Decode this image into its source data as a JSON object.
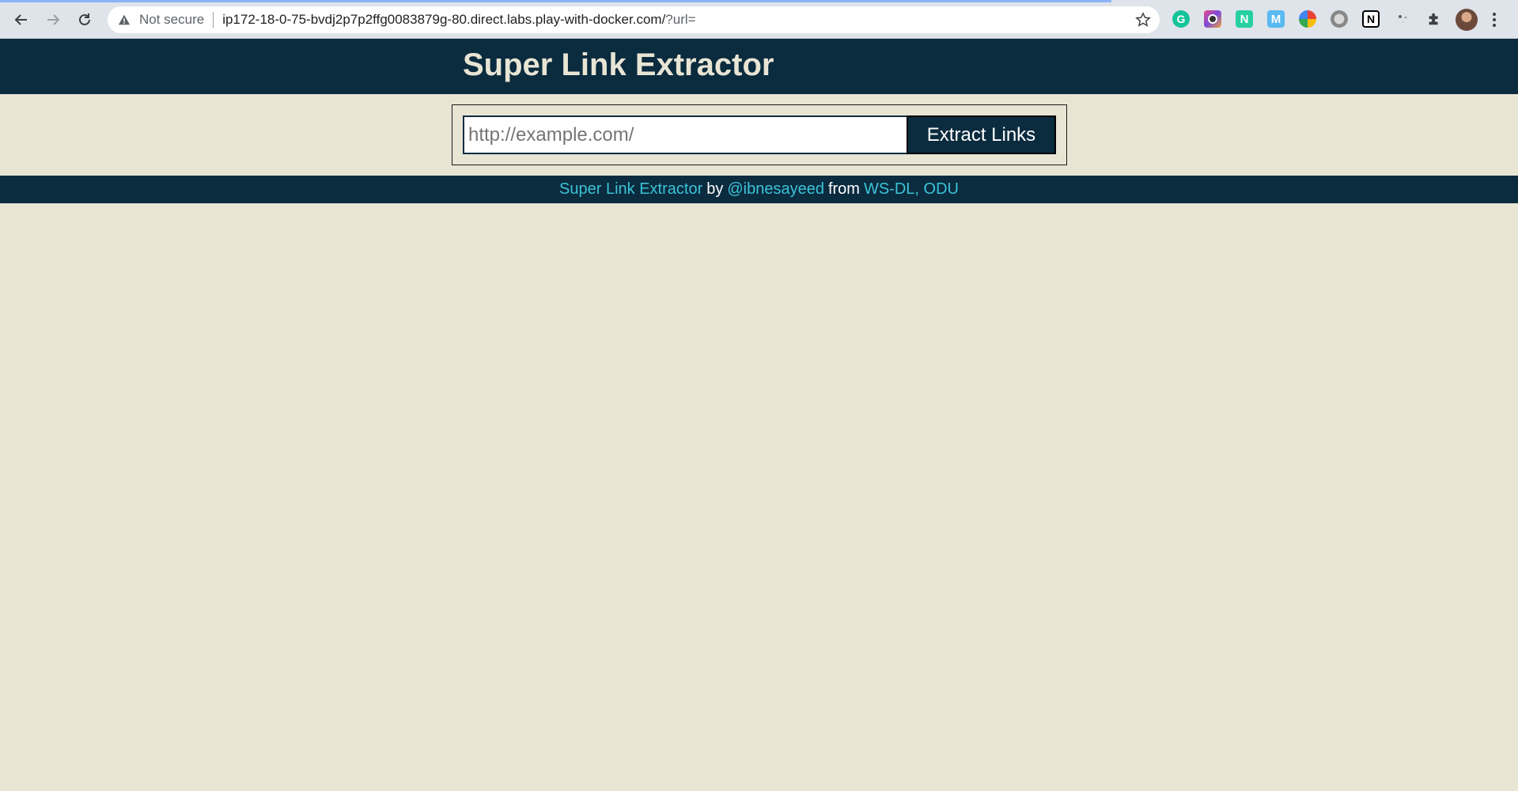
{
  "browser": {
    "security_label": "Not secure",
    "url_host_path": "ip172-18-0-75-bvdj2p7p2ffg0083879g-80.direct.labs.play-with-docker.com/",
    "url_query": "?url=",
    "icons": [
      "back-arrow-icon",
      "forward-arrow-icon",
      "reload-icon",
      "warning-icon",
      "star-icon",
      "grammarly-icon",
      "extension-icon",
      "notion-icon",
      "extensions-puzzle-icon",
      "profile-avatar",
      "menu-kebab-icon"
    ]
  },
  "header": {
    "title": "Super Link Extractor"
  },
  "form": {
    "url_placeholder": "http://example.com/",
    "url_value": "",
    "submit_label": "Extract Links"
  },
  "footer": {
    "app_link": "Super Link Extractor",
    "by_text": "by",
    "author_link": "@ibnesayeed",
    "from_text": "from",
    "org_link": "WS-DL, ODU"
  },
  "colors": {
    "page_background": "#e8e5d5",
    "header_background": "#0b2b3e",
    "link": "#3cc3d8"
  }
}
